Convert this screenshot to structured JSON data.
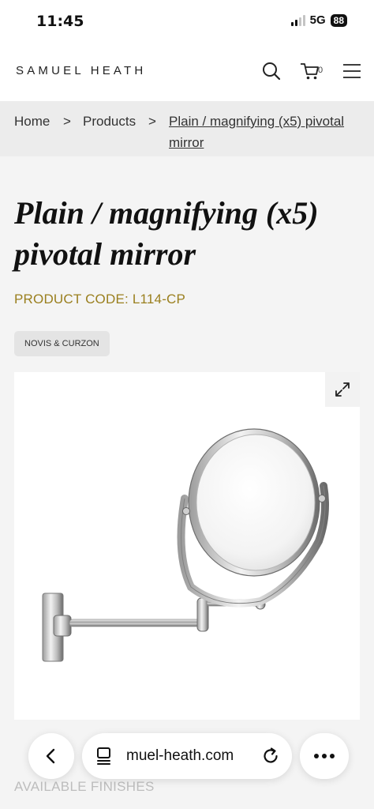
{
  "status_bar": {
    "time": "11:45",
    "network": "5G",
    "battery": "88"
  },
  "header": {
    "brand": "SAMUEL HEATH",
    "cart_count": "0"
  },
  "breadcrumb": {
    "home": "Home",
    "separator": ">",
    "products": "Products",
    "current": "Plain / magnifying (x5) pivotal mirror"
  },
  "product": {
    "title": "Plain / magnifying (x5) pivotal mirror",
    "code": "PRODUCT CODE: L114-CP",
    "tag": "NOVIS & CURZON"
  },
  "sections": {
    "finishes": "AVAILABLE FINISHES"
  },
  "browser": {
    "url": "muel-heath.com"
  },
  "colors": {
    "accent_gold": "#9a7f1e",
    "page_bg": "#f4f4f4",
    "breadcrumb_bg": "#ececec"
  }
}
